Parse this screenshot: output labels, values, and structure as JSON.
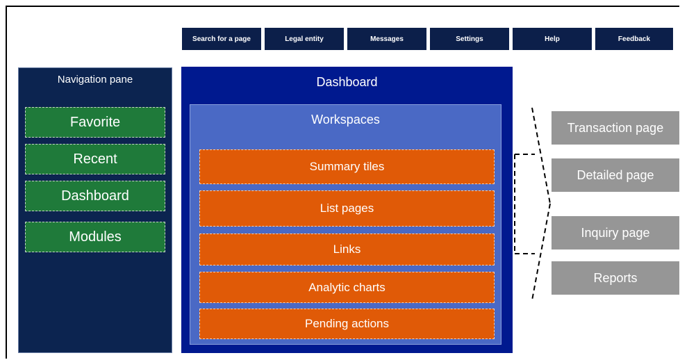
{
  "toolbar": {
    "buttons": [
      {
        "label": "Search for a page"
      },
      {
        "label": "Legal entity"
      },
      {
        "label": "Messages"
      },
      {
        "label": "Settings"
      },
      {
        "label": "Help"
      },
      {
        "label": "Feedback"
      }
    ]
  },
  "navigation_pane": {
    "title": "Navigation pane",
    "items": [
      {
        "label": "Favorite"
      },
      {
        "label": "Recent"
      },
      {
        "label": "Dashboard"
      },
      {
        "label": "Modules"
      }
    ]
  },
  "dashboard": {
    "title": "Dashboard",
    "workspaces": {
      "title": "Workspaces",
      "items": [
        {
          "label": "Summary tiles"
        },
        {
          "label": "List pages"
        },
        {
          "label": "Links"
        },
        {
          "label": "Analytic charts"
        },
        {
          "label": "Pending actions"
        }
      ]
    }
  },
  "pages": [
    {
      "label": "Transaction page"
    },
    {
      "label": "Detailed page"
    },
    {
      "label": "Inquiry page"
    },
    {
      "label": "Reports"
    }
  ],
  "colors": {
    "toolbar": "#0c1f4a",
    "navigation_pane": "#0c2450",
    "nav_item": "#1f7a3a",
    "dashboard": "#00198f",
    "workspaces": "#4a69c5",
    "workspace_item": "#e05a07",
    "page_box": "#969696"
  }
}
